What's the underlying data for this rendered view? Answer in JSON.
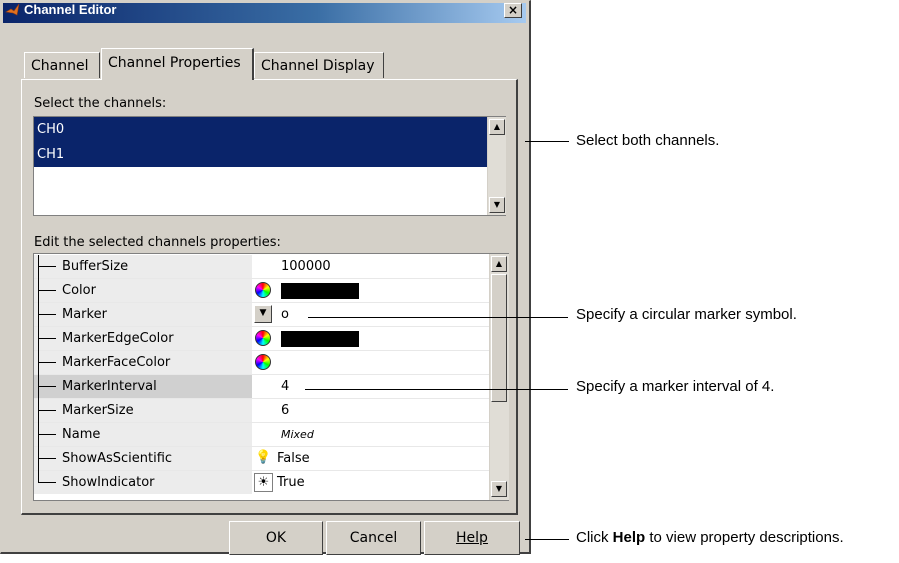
{
  "window": {
    "title": "Channel Editor",
    "close_label": "×"
  },
  "tabs": [
    {
      "label": "Channel"
    },
    {
      "label": "Channel Properties"
    },
    {
      "label": "Channel Display"
    }
  ],
  "channels": {
    "label": "Select the channels:",
    "items": [
      "CH0",
      "CH1"
    ]
  },
  "properties": {
    "label": "Edit the selected channels properties:",
    "rows": [
      {
        "name": "BufferSize",
        "value": "100000"
      },
      {
        "name": "Color",
        "value": ""
      },
      {
        "name": "Marker",
        "value": "o"
      },
      {
        "name": "MarkerEdgeColor",
        "value": ""
      },
      {
        "name": "MarkerFaceColor",
        "value": ""
      },
      {
        "name": "MarkerInterval",
        "value": "4"
      },
      {
        "name": "MarkerSize",
        "value": "6"
      },
      {
        "name": "Name",
        "value": "Mixed"
      },
      {
        "name": "ShowAsScientific",
        "value": "False"
      },
      {
        "name": "ShowIndicator",
        "value": "True"
      }
    ]
  },
  "buttons": {
    "ok": "OK",
    "cancel": "Cancel",
    "help": "Help"
  },
  "callouts": {
    "select": "Select both channels.",
    "marker": "Specify a circular marker symbol.",
    "interval": "Specify a marker interval of 4.",
    "help_prefix": "Click ",
    "help_bold": "Help",
    "help_suffix": " to view property descriptions."
  },
  "colors": {
    "title_bar": "#0a246a",
    "selection": "#0a246a",
    "dialog": "#d4d0c8"
  }
}
